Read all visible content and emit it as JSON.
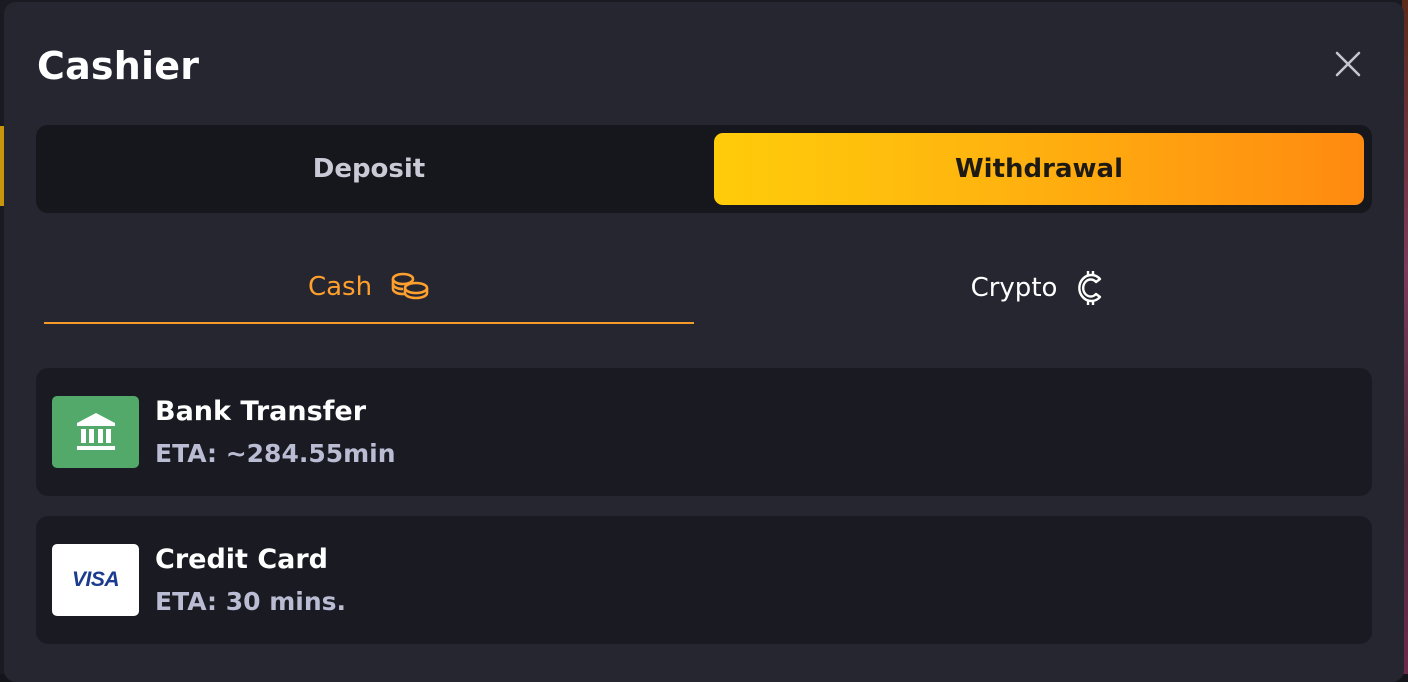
{
  "modal": {
    "title": "Cashier"
  },
  "main_tabs": [
    {
      "label": "Deposit",
      "active": false
    },
    {
      "label": "Withdrawal",
      "active": true
    }
  ],
  "sub_tabs": [
    {
      "label": "Cash",
      "icon": "coins-icon",
      "active": true
    },
    {
      "label": "Crypto",
      "icon": "crypto-coin-icon",
      "active": false
    }
  ],
  "methods": [
    {
      "name": "Bank Transfer",
      "eta": "ETA: ~284.55min",
      "icon": "bank-icon"
    },
    {
      "name": "Credit Card",
      "eta": "ETA: 30 mins.",
      "icon": "visa-logo",
      "logo_text": "VISA"
    }
  ],
  "colors": {
    "accent": "#f39a2b",
    "active_tab_start": "#ffcc0a",
    "active_tab_end": "#ff8a10",
    "bank_icon_bg": "#52a96a",
    "visa_blue": "#1a3b8f"
  }
}
